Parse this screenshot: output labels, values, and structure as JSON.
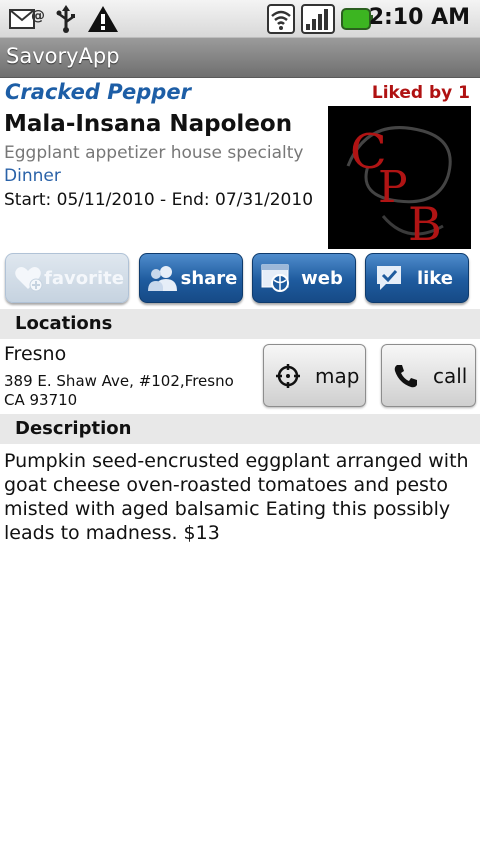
{
  "status_bar": {
    "time": "2:10 AM",
    "icons": [
      "mail-icon",
      "usb-icon",
      "warning-icon",
      "wifi-icon",
      "signal-icon",
      "battery-icon"
    ],
    "battery_color": "#3cb521"
  },
  "app": {
    "title": "SavoryApp"
  },
  "item": {
    "restaurant": "Cracked Pepper",
    "liked": "Liked by 1",
    "name": "Mala-Insana Napoleon",
    "subtitle": "Eggplant appetizer house specialty",
    "meal": "Dinner",
    "dates": "Start: 05/11/2010 - End: 07/31/2010",
    "logo_letters": [
      "C",
      "P",
      "B"
    ]
  },
  "actions": {
    "favorite": "favorite",
    "share": "share",
    "web": "web",
    "like": "like"
  },
  "locations": {
    "header": "Locations",
    "city": "Fresno",
    "address": "389 E. Shaw Ave, #102,Fresno CA 93710",
    "map_label": "map",
    "call_label": "call"
  },
  "description": {
    "header": "Description",
    "text": "Pumpkin seed-encrusted eggplant arranged with goat cheese oven-roasted tomatoes and pesto misted with aged balsamic Eating this possibly leads to madness. $13"
  },
  "colors": {
    "accent_blue": "#1d5ea6",
    "liked_red": "#b01212",
    "button_blue": "#1e5b9e"
  }
}
